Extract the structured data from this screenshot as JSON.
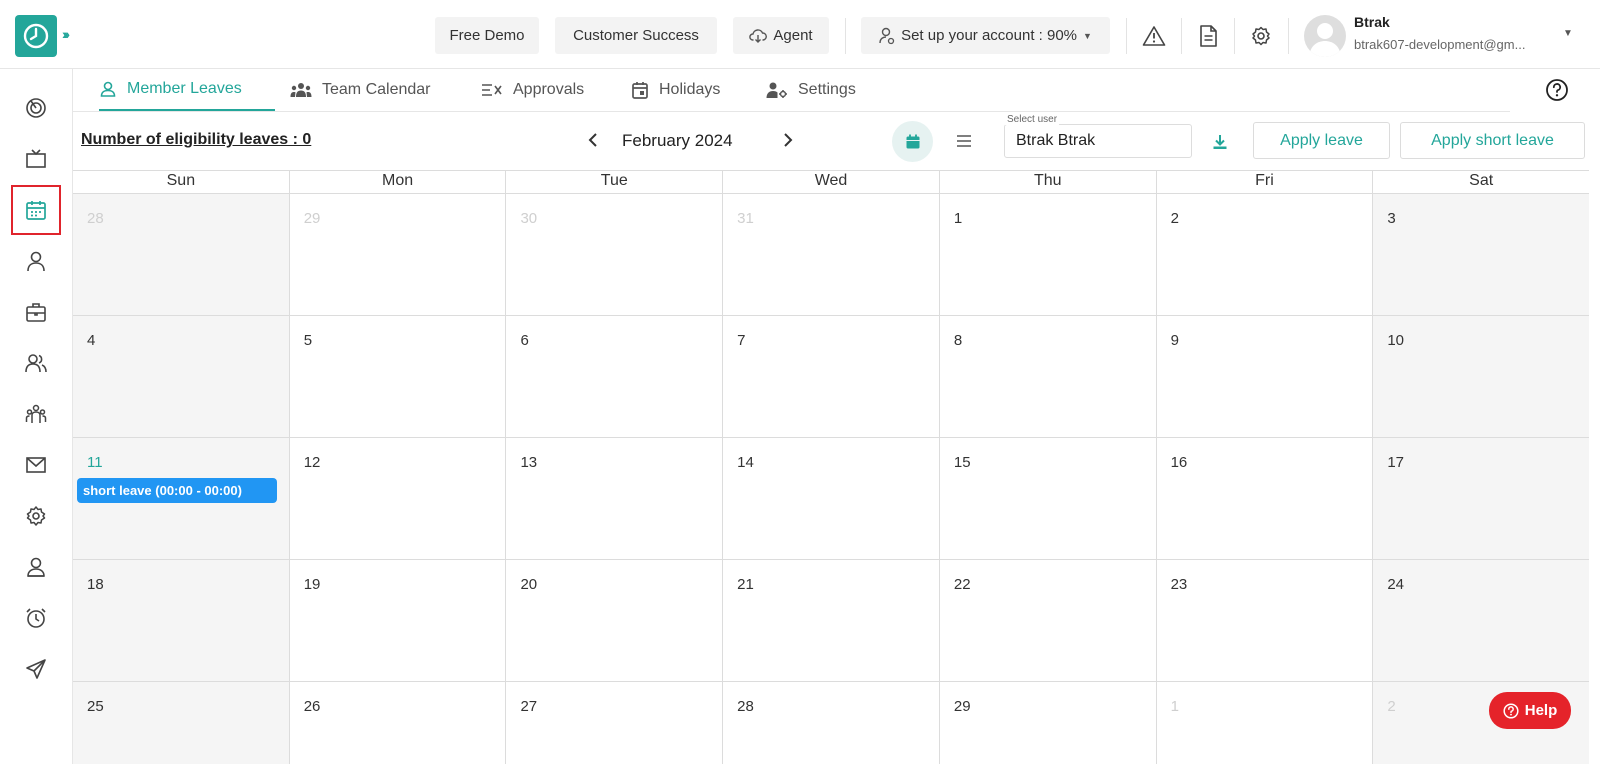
{
  "header": {
    "free_demo": "Free Demo",
    "customer_success": "Customer Success",
    "agent": "Agent",
    "setup": "Set up your account : 90%",
    "user_name": "Btrak",
    "user_email": "btrak607-development@gm..."
  },
  "tabs": {
    "member_leaves": "Member Leaves",
    "team_calendar": "Team Calendar",
    "approvals": "Approvals",
    "holidays": "Holidays",
    "settings": "Settings"
  },
  "toolbar": {
    "eligibility": "Number of eligibility leaves : 0",
    "month": "February 2024",
    "select_user_label": "Select user",
    "select_user_value": "Btrak Btrak",
    "apply_leave": "Apply leave",
    "apply_short_leave": "Apply short leave"
  },
  "calendar": {
    "day_names": [
      "Sun",
      "Mon",
      "Tue",
      "Wed",
      "Thu",
      "Fri",
      "Sat"
    ],
    "weeks": [
      [
        {
          "d": "28",
          "o": true
        },
        {
          "d": "29",
          "o": true
        },
        {
          "d": "30",
          "o": true
        },
        {
          "d": "31",
          "o": true
        },
        {
          "d": "1"
        },
        {
          "d": "2"
        },
        {
          "d": "3"
        }
      ],
      [
        {
          "d": "4"
        },
        {
          "d": "5"
        },
        {
          "d": "6"
        },
        {
          "d": "7"
        },
        {
          "d": "8"
        },
        {
          "d": "9"
        },
        {
          "d": "10"
        }
      ],
      [
        {
          "d": "11",
          "today": true,
          "event": "short leave (00:00 - 00:00)"
        },
        {
          "d": "12"
        },
        {
          "d": "13"
        },
        {
          "d": "14"
        },
        {
          "d": "15"
        },
        {
          "d": "16"
        },
        {
          "d": "17"
        }
      ],
      [
        {
          "d": "18"
        },
        {
          "d": "19"
        },
        {
          "d": "20"
        },
        {
          "d": "21"
        },
        {
          "d": "22"
        },
        {
          "d": "23"
        },
        {
          "d": "24"
        }
      ],
      [
        {
          "d": "25"
        },
        {
          "d": "26"
        },
        {
          "d": "27"
        },
        {
          "d": "28"
        },
        {
          "d": "29"
        },
        {
          "d": "1",
          "o": true
        },
        {
          "d": "2",
          "o": true
        }
      ]
    ]
  },
  "help_label": "Help",
  "colors": {
    "accent": "#23a69a",
    "event": "#2196f3",
    "help": "#e5232a",
    "highlight": "#e0242c"
  }
}
